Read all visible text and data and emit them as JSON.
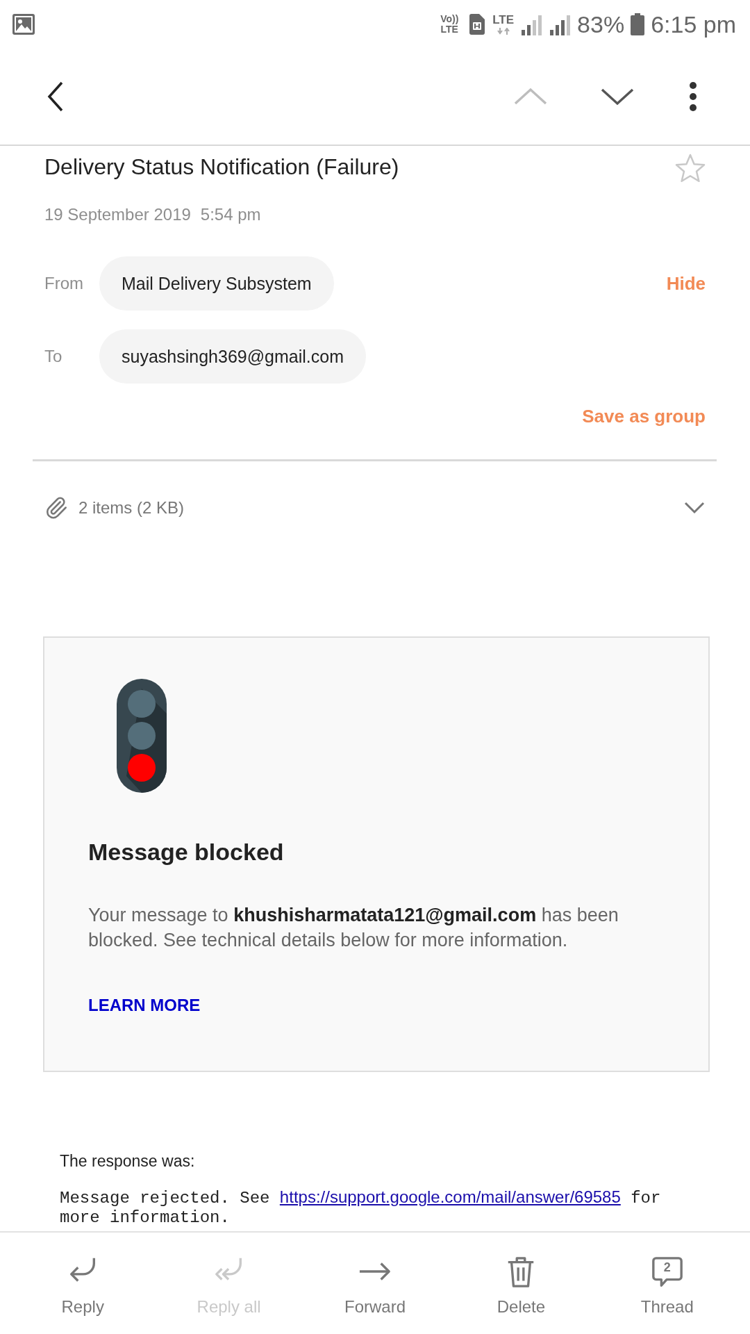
{
  "status_bar": {
    "volte": "Vo)) LTE",
    "network": "LTE",
    "battery": "83%",
    "time": "6:15 pm"
  },
  "toolbar": {
    "previous_disabled": true,
    "next_disabled": false
  },
  "message": {
    "subject": "Delivery Status Notification (Failure)",
    "starred": false,
    "date": "19 September 2019",
    "time": "5:54 pm"
  },
  "recipients": [
    {
      "label": "From",
      "value": "Mail Delivery Subsystem",
      "action": "Hide"
    },
    {
      "label": "To",
      "value": "suyashsingh369@gmail.com"
    }
  ],
  "save_as_group": "Save as group",
  "attachments": {
    "summary": "2 items (2 KB)",
    "expanded": false
  },
  "notice_card": {
    "title": "Message blocked",
    "body": "Your message to **khushisharmatata121@gmail.com** has been blocked. See technical details below for more information.",
    "link": "LEARN MORE"
  },
  "response": {
    "intro": "The response was:",
    "text_before": "Message rejected. See",
    "link": "https://support.google.com/mail/answer/69585",
    "text_after": "for more information."
  },
  "actions": [
    {
      "kind": "reply",
      "label": "Reply",
      "disabled": false
    },
    {
      "kind": "reply_all",
      "label": "Reply all",
      "disabled": true
    },
    {
      "kind": "forward",
      "label": "Forward",
      "disabled": false
    },
    {
      "kind": "delete",
      "label": "Delete",
      "disabled": false
    },
    {
      "kind": "thread",
      "label": "Thread",
      "badge": "2",
      "disabled": false
    }
  ]
}
